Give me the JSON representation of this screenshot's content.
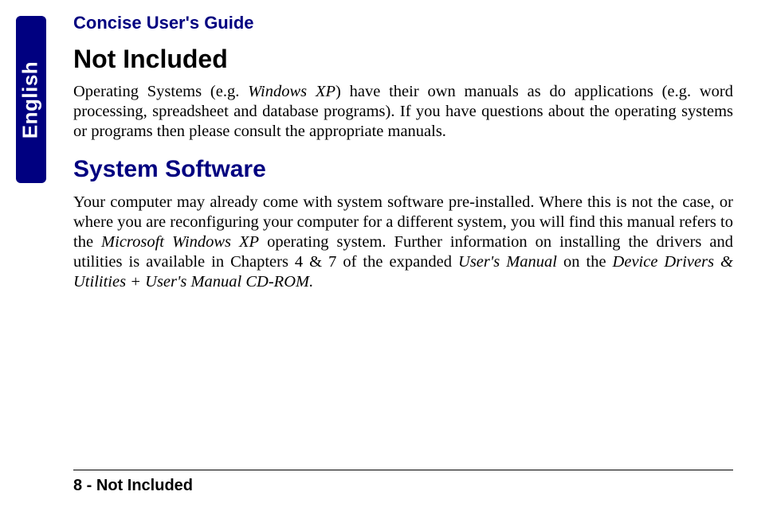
{
  "lang_tab": "English",
  "header": "Concise User's Guide",
  "section1": {
    "title": "Not Included",
    "para1_a": "Operating Systems (e.g. ",
    "para1_b": "Windows XP",
    "para1_c": ") have their own manuals as do applications (e.g. word processing, spreadsheet and database programs). If you have questions about the operating systems or programs then please consult the appropriate manuals."
  },
  "section2": {
    "title": "System Software",
    "para1_a": "Your computer may already come with system software pre-installed. Where this is not the case, or where you are reconfiguring your computer for a different system, you will find this manual refers to the ",
    "para1_b": "Microsoft Windows XP",
    "para1_c": " operating system. Further information on installing the drivers and utilities is available in Chapters 4 & 7 of the expanded ",
    "para1_d": "User's Manual",
    "para1_e": " on the ",
    "para1_f": "Device Drivers & Utilities + User's Manual CD-ROM.",
    "para1_g": ""
  },
  "footer": "8 - Not Included"
}
